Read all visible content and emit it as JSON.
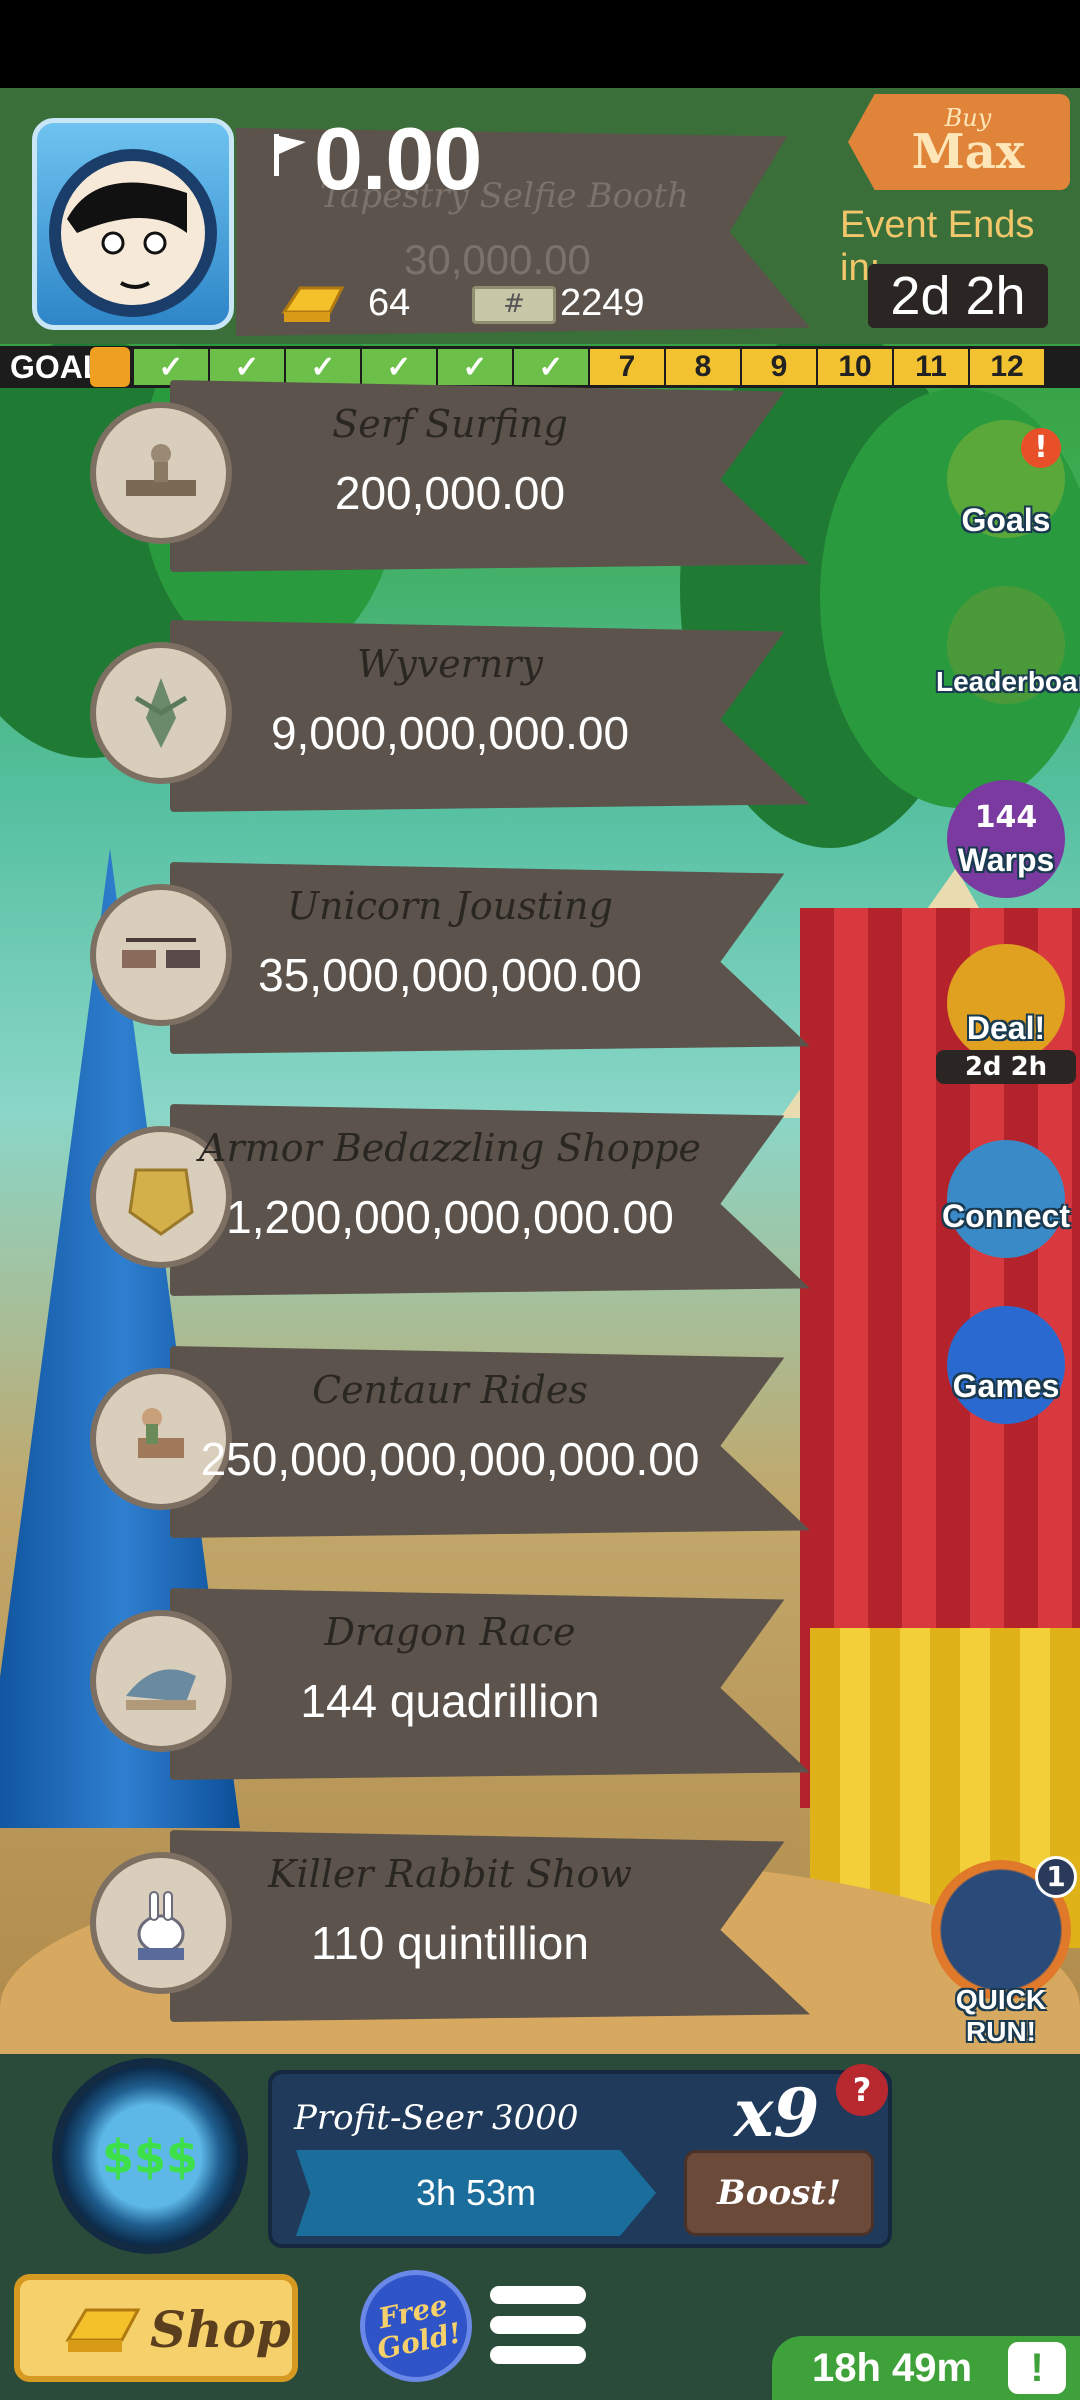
{
  "header": {
    "cash": "0.00",
    "ghost_business_name": "Tapestry Selfie Booth",
    "ghost_business_value": "30,000.00",
    "gold": "64",
    "bills": "2249",
    "buy_max": {
      "top": "Buy",
      "bottom": "Max"
    },
    "event_label": "Event Ends in:",
    "event_time": "2d 2h"
  },
  "goals": {
    "label": "GOALS",
    "cells": [
      "✓",
      "✓",
      "✓",
      "✓",
      "✓",
      "✓",
      "7",
      "8",
      "9",
      "10",
      "11",
      "12"
    ],
    "completed_count": 6
  },
  "businesses": [
    {
      "name": "Serf Surfing",
      "value": "200,000.00",
      "icon": "serf-surfing-icon"
    },
    {
      "name": "Wyvernry",
      "value": "9,000,000,000.00",
      "icon": "wyvern-icon"
    },
    {
      "name": "Unicorn Jousting",
      "value": "35,000,000,000.00",
      "icon": "unicorn-joust-icon"
    },
    {
      "name": "Armor Bedazzling Shoppe",
      "value": "1,200,000,000,000.00",
      "icon": "armor-icon"
    },
    {
      "name": "Centaur Rides",
      "value": "250,000,000,000,000.00",
      "icon": "centaur-icon"
    },
    {
      "name": "Dragon Race",
      "value": "144 quadrillion",
      "icon": "dragon-icon"
    },
    {
      "name": "Killer Rabbit Show",
      "value": "110 quintillion",
      "icon": "rabbit-icon"
    }
  ],
  "side_buttons": {
    "goals": "Goals",
    "leaderboard": "Leaderboard",
    "warps": "Warps",
    "warps_count": "144",
    "deal": "Deal!",
    "deal_time": "2d 2h",
    "connect": "Connect",
    "games": "Games",
    "quick_run": "QUICK RUN!",
    "quick_run_badge": "1"
  },
  "manager": {
    "orb_symbol": "$$$",
    "name": "Profit-Seer 3000",
    "multiplier": "x9",
    "help": "?",
    "timer": "3h 53m",
    "boost": "Boost!"
  },
  "footer": {
    "shop": "Shop",
    "free_gold": "Free Gold!",
    "event_timer": "18h 49m",
    "alert": "!"
  },
  "colors": {
    "banner": "#5b534c",
    "goal_done": "#6cc04a",
    "goal_todo": "#f2c230",
    "event_text": "#f2c66a"
  }
}
